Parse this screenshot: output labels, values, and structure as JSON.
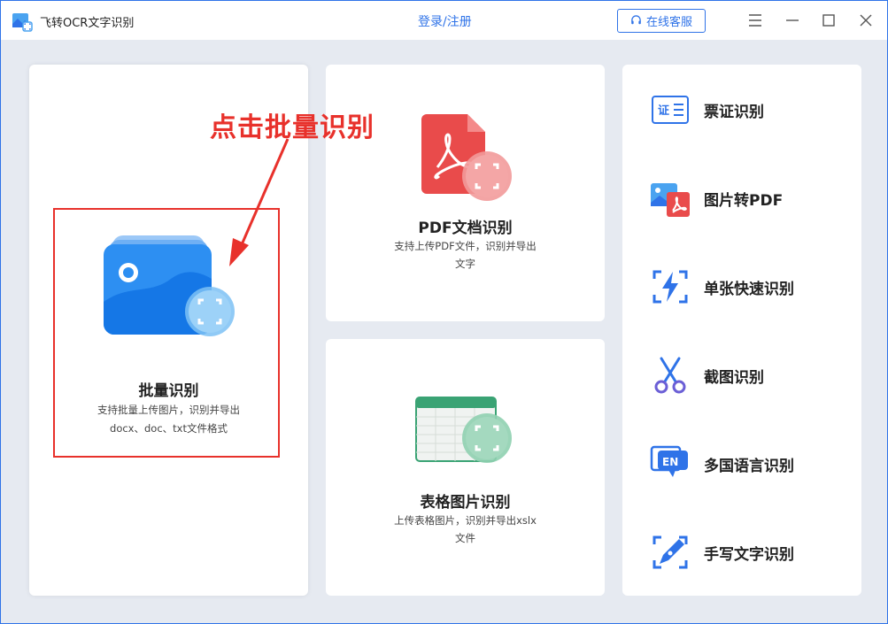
{
  "app": {
    "title": "飞转OCR文字识别"
  },
  "header": {
    "login": "登录/注册",
    "support": "在线客服"
  },
  "annotation": {
    "text": "点击批量识别"
  },
  "batch": {
    "title": "批量识别",
    "desc1": "支持批量上传图片，识别并导出",
    "desc2": "docx、doc、txt文件格式"
  },
  "pdf": {
    "title": "PDF文档识别",
    "desc1": "支持上传PDF文件，识别并导出",
    "desc2": "文字"
  },
  "table": {
    "title": "表格图片识别",
    "desc1": "上传表格图片，识别并导出xslx",
    "desc2": "文件"
  },
  "tools": [
    {
      "label": "票证识别",
      "icon": "certificate-icon",
      "badge": "证"
    },
    {
      "label": "图片转PDF",
      "icon": "image-to-pdf-icon"
    },
    {
      "label": "单张快速识别",
      "icon": "lightning-scan-icon"
    },
    {
      "label": "截图识别",
      "icon": "scissors-icon"
    },
    {
      "label": "多国语言识别",
      "icon": "language-icon",
      "badge": "EN"
    },
    {
      "label": "手写文字识别",
      "icon": "pen-nib-icon"
    }
  ],
  "colors": {
    "accent": "#2f73e8",
    "annotation": "#e8312b",
    "pdf_red": "#e94b4b",
    "table_green": "#3aa374"
  }
}
